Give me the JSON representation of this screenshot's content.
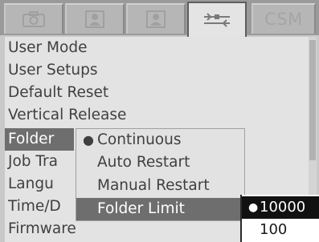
{
  "tabs": [
    {
      "icon": "camera-icon",
      "label": ""
    },
    {
      "icon": "portrait-icon",
      "label": ""
    },
    {
      "icon": "portrait-alt-icon",
      "label": ""
    },
    {
      "icon": "tools-icon",
      "label": ""
    },
    {
      "icon": "",
      "label": "CSM"
    }
  ],
  "menu": {
    "items": [
      "User Mode",
      "User Setups",
      "Default Reset",
      "Vertical Release",
      "Folder",
      "Job Tra",
      "Langu",
      "Time/D",
      "Firmware"
    ],
    "selected_index": 4
  },
  "submenu": {
    "items": [
      "Continuous",
      "Auto Restart",
      "Manual Restart",
      "Folder Limit"
    ],
    "checked_index": 0,
    "selected_index": 3
  },
  "submenu2": {
    "items": [
      "10000",
      "100"
    ],
    "selected_index": 0
  },
  "colors": {
    "tabbar": "#9a9a9a",
    "menu_bg": "#e3e3e3",
    "highlight": "#6e6e6e",
    "text": "#404040"
  }
}
